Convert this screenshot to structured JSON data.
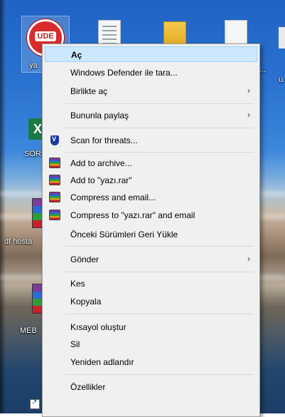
{
  "desktop": {
    "icons": [
      {
        "label": "ya",
        "icon": "ude-icon"
      },
      {
        "label": "...",
        "icon": "document-icon"
      },
      {
        "label": "SOR",
        "icon": "excel-icon"
      },
      {
        "label": "df hosta",
        "icon": "winrar-icon"
      },
      {
        "label": "MEB",
        "icon": "winrar-icon"
      },
      {
        "label": "u",
        "icon": "document-icon"
      }
    ]
  },
  "context_menu": {
    "items": [
      {
        "label": "Aç",
        "bold": true,
        "highlighted": true
      },
      {
        "label": "Windows Defender ile tara..."
      },
      {
        "label": "Birlikte aç",
        "submenu": true
      },
      {
        "label": "Bununla paylaş",
        "submenu": true
      },
      {
        "label": "Scan for threats...",
        "icon": "shield-icon"
      },
      {
        "label": "Add to archive...",
        "icon": "winrar-icon"
      },
      {
        "label": "Add to \"yazı.rar\"",
        "icon": "winrar-icon"
      },
      {
        "label": "Compress and email...",
        "icon": "winrar-icon"
      },
      {
        "label": "Compress to \"yazı.rar\" and email",
        "icon": "winrar-icon"
      },
      {
        "label": "Önceki Sürümleri Geri Yükle"
      },
      {
        "label": "Gönder",
        "submenu": true
      },
      {
        "label": "Kes"
      },
      {
        "label": "Kopyala"
      },
      {
        "label": "Kısayol oluştur"
      },
      {
        "label": "Sil"
      },
      {
        "label": "Yeniden adlandır"
      },
      {
        "label": "Özellikler"
      }
    ],
    "submenu_arrow": "›"
  }
}
